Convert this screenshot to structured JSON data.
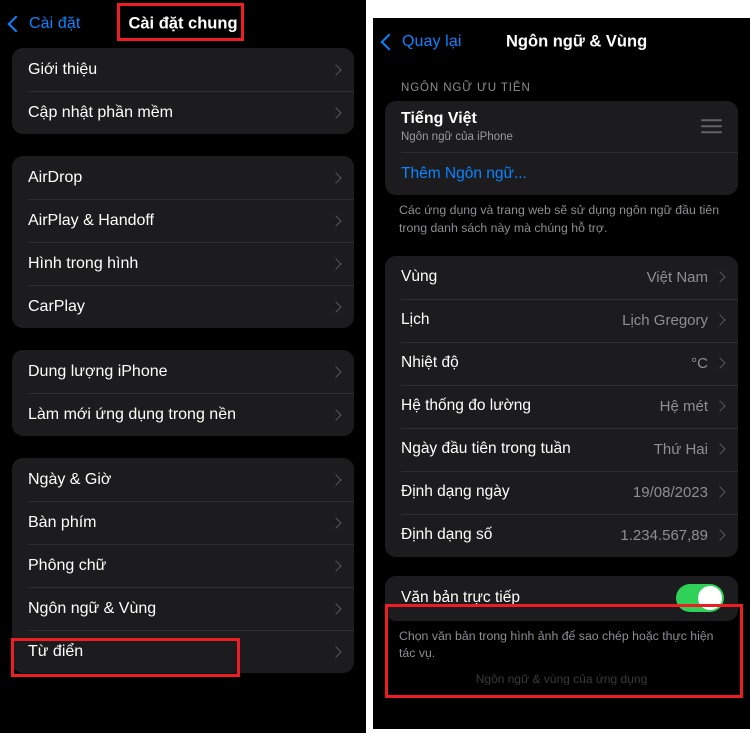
{
  "left_panel": {
    "nav": {
      "back_label": "Cài đặt",
      "back_icon": "chevron-left-icon",
      "title": "Cài đặt chung"
    },
    "groups": [
      {
        "rows": [
          {
            "label": "Giới thiệu",
            "accessory": "chevron-right-icon"
          },
          {
            "label": "Cập nhật phần mềm",
            "accessory": "chevron-right-icon"
          }
        ]
      },
      {
        "rows": [
          {
            "label": "AirDrop",
            "accessory": "chevron-right-icon"
          },
          {
            "label": "AirPlay & Handoff",
            "accessory": "chevron-right-icon"
          },
          {
            "label": "Hình trong hình",
            "accessory": "chevron-right-icon"
          },
          {
            "label": "CarPlay",
            "accessory": "chevron-right-icon"
          }
        ]
      },
      {
        "rows": [
          {
            "label": "Dung lượng iPhone",
            "accessory": "chevron-right-icon"
          },
          {
            "label": "Làm mới ứng dụng trong nền",
            "accessory": "chevron-right-icon"
          }
        ]
      },
      {
        "rows": [
          {
            "label": "Ngày & Giờ",
            "accessory": "chevron-right-icon"
          },
          {
            "label": "Bàn phím",
            "accessory": "chevron-right-icon"
          },
          {
            "label": "Phông chữ",
            "accessory": "chevron-right-icon"
          },
          {
            "label": "Ngôn ngữ & Vùng",
            "accessory": "chevron-right-icon"
          },
          {
            "label": "Từ điển",
            "accessory": "chevron-right-icon"
          }
        ]
      }
    ]
  },
  "right_panel": {
    "nav": {
      "back_label": "Quay lại",
      "back_icon": "chevron-left-icon",
      "title": "Ngôn ngữ & Vùng"
    },
    "preferred_languages": {
      "section_header": "NGÔN NGỮ ƯU TIÊN",
      "language": {
        "title": "Tiếng Việt",
        "subtitle": "Ngôn ngữ của iPhone",
        "handle_icon": "reorder-handle-icon"
      },
      "add_language_label": "Thêm Ngôn ngữ...",
      "footnote": "Các ứng dụng và trang web sẽ sử dụng ngôn ngữ đầu tiên trong danh sách này mà chúng hỗ trợ."
    },
    "region_rows": [
      {
        "label": "Vùng",
        "value": "Việt Nam",
        "accessory": "chevron-right-icon"
      },
      {
        "label": "Lịch",
        "value": "Lịch Gregory",
        "accessory": "chevron-right-icon"
      },
      {
        "label": "Nhiệt độ",
        "value": "°C",
        "accessory": "chevron-right-icon"
      },
      {
        "label": "Hệ thống đo lường",
        "value": "Hệ mét",
        "accessory": "chevron-right-icon"
      },
      {
        "label": "Ngày đầu tiên trong tuần",
        "value": "Thứ Hai",
        "accessory": "chevron-right-icon"
      },
      {
        "label": "Định dạng ngày",
        "value": "19/08/2023",
        "accessory": "chevron-right-icon"
      },
      {
        "label": "Định dạng số",
        "value": "1.234.567,89",
        "accessory": "chevron-right-icon"
      }
    ],
    "live_text": {
      "label": "Văn bản trực tiếp",
      "toggle_state": "on",
      "footnote": "Chọn văn bản trong hình ảnh để sao chép hoặc thực hiện tác vụ."
    },
    "cut_off_row": "Ngôn ngữ & vùng của ứng dụng"
  },
  "annotations": {
    "highlight_color": "#ee1c23",
    "boxes": [
      {
        "name": "general-settings-title"
      },
      {
        "name": "language-region-row"
      },
      {
        "name": "live-text-section"
      }
    ]
  },
  "colors": {
    "background": "#000000",
    "card": "#1c1c1e",
    "accent_blue": "#0a84ff",
    "toggle_green": "#30d158",
    "secondary_text": "#8e8e93"
  }
}
